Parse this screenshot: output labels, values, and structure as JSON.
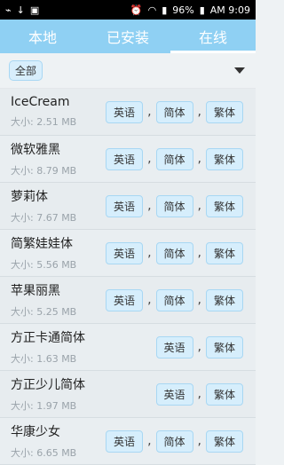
{
  "status": {
    "notif_icons": [
      "usb-icon",
      "download-icon",
      "gallery-icon"
    ],
    "right_icons": [
      "alarm-icon",
      "wifi-icon",
      "signal-icon",
      "battery-icon"
    ],
    "battery_text": "96%",
    "time": "AM 9:09"
  },
  "tabs": [
    {
      "label": "本地"
    },
    {
      "label": "已安装"
    },
    {
      "label": "在线"
    }
  ],
  "filter": {
    "label": "全部"
  },
  "actions": {
    "en": "英语",
    "sc": "简体",
    "tc": "繁体",
    "sep": ","
  },
  "fonts": [
    {
      "name": "IceCream",
      "size": "大小: 2.51 MB"
    },
    {
      "name": "微软雅黑",
      "size": "大小: 8.79 MB"
    },
    {
      "name": "萝莉体",
      "size": "大小: 7.67 MB"
    },
    {
      "name": "简繁娃娃体",
      "size": "大小: 5.56 MB"
    },
    {
      "name": "苹果丽黑",
      "size": "大小: 5.25 MB"
    },
    {
      "name": "方正卡通简体",
      "size": "大小: 1.63 MB"
    },
    {
      "name": "方正少儿简体",
      "size": "大小: 1.97 MB"
    },
    {
      "name": "华康少女",
      "size": "大小: 6.65 MB"
    }
  ]
}
